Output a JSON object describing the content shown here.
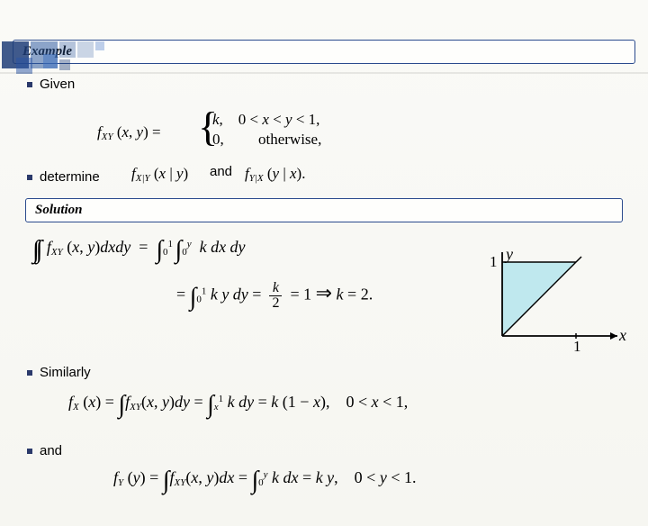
{
  "headings": {
    "example": "Example",
    "solution": "Solution"
  },
  "bullets": {
    "given": "Given",
    "determine": "determine",
    "similarly": "Similarly",
    "and": "and"
  },
  "given": {
    "lhs": "f_{XY}(x, y) =",
    "case1_val": "k,",
    "case1_cond": "0 < x < y < 1,",
    "case2_val": "0,",
    "case2_cond": "otherwise,"
  },
  "determine": {
    "f1": "f_{X|Y}(x | y)",
    "joiner": "and",
    "f2": "f_{Y|X}(y | x)."
  },
  "solution_steps": {
    "line1": "\\int\\int f_{XY}(x, y) dx dy = \\int_0^1 \\int_0^y k\\,dx\\,dy",
    "line2_lhs": "= \\int_0^1 k\\,y\\,dy =",
    "line2_frac_num": "k",
    "line2_frac_den": "2",
    "line2_rhs": "= 1 \\Rightarrow k = 2."
  },
  "marginals": {
    "fx": "f_X(x) = \\int f_{XY}(x, y) dy = \\int_x^1 k\\,dy = k(1 - x),\\quad 0 < x < 1,",
    "fy": "f_Y(y) = \\int f_{XY}(x, y) dx = \\int_0^y k\\,dx = k\\,y,\\quad 0 < y < 1."
  },
  "plot": {
    "x_label": "x",
    "y_label": "y",
    "tick": "1"
  },
  "chart_data": {
    "type": "area",
    "title": "",
    "xlabel": "x",
    "ylabel": "y",
    "xlim": [
      0,
      1.2
    ],
    "ylim": [
      0,
      1.2
    ],
    "ticks_x": [
      1
    ],
    "ticks_y": [
      1
    ],
    "region_description": "triangular region 0 < x < y < 1",
    "vertices": [
      [
        0,
        0
      ],
      [
        1,
        1
      ],
      [
        0,
        1
      ]
    ],
    "fill_color": "#bfe8ee"
  }
}
